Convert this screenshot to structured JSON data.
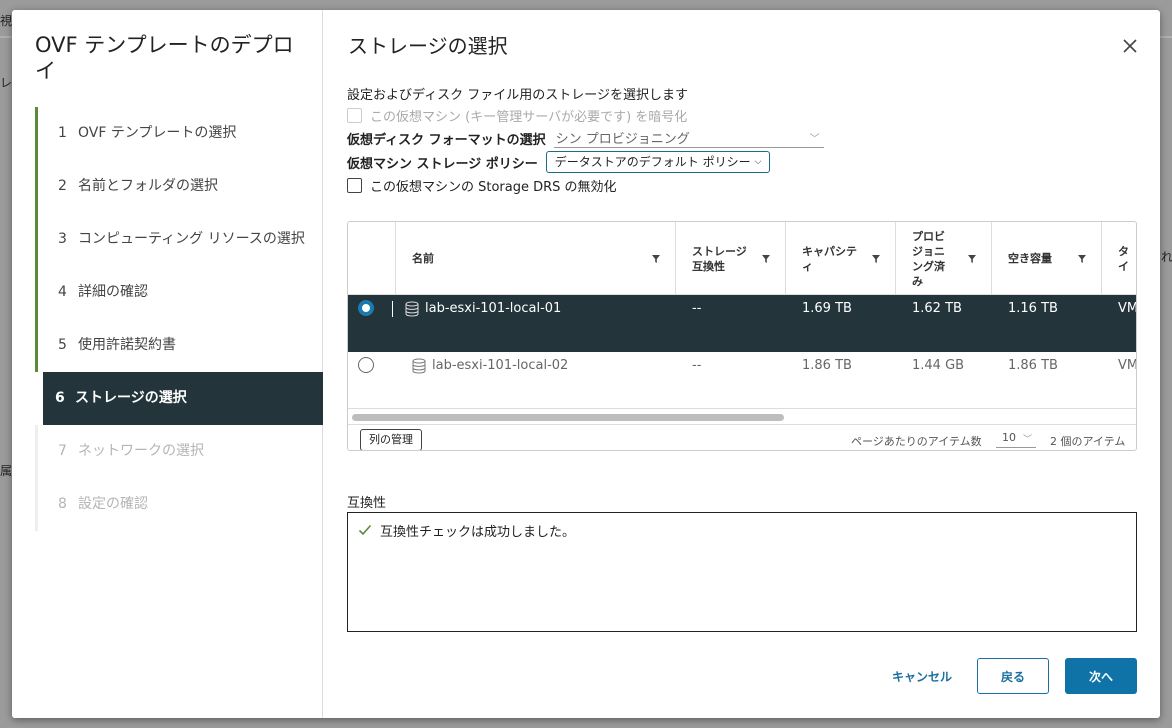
{
  "background": {
    "fragments": [
      "視",
      "レ",
      "属",
      "れ"
    ]
  },
  "wizard": {
    "title": "OVF テンプレートのデプロイ",
    "steps": [
      {
        "num": "1",
        "label": "OVF テンプレートの選択"
      },
      {
        "num": "2",
        "label": "名前とフォルダの選択"
      },
      {
        "num": "3",
        "label": "コンピューティング リソースの選択"
      },
      {
        "num": "4",
        "label": "詳細の確認"
      },
      {
        "num": "5",
        "label": "使用許諾契約書"
      },
      {
        "num": "6",
        "label": "ストレージの選択"
      },
      {
        "num": "7",
        "label": "ネットワークの選択"
      },
      {
        "num": "8",
        "label": "設定の確認"
      }
    ]
  },
  "page": {
    "title": "ストレージの選択",
    "description": "設定およびディスク ファイル用のストレージを選択します",
    "encrypt_label": "この仮想マシン (キー管理サーバが必要です) を暗号化",
    "disk_format_label": "仮想ディスク フォーマットの選択",
    "disk_format_value": "シン プロビジョニング",
    "policy_label": "仮想マシン ストレージ ポリシー",
    "policy_value": "データストアのデフォルト ポリシー",
    "sdrs_label": "この仮想マシンの Storage DRS の無効化"
  },
  "table": {
    "headers": {
      "name": "名前",
      "compat": "ストレージ互換性",
      "capacity": "キャパシティ",
      "provisioned": "プロビジョニング済み",
      "free": "空き容量",
      "type": "タイ"
    },
    "rows": [
      {
        "name": "lab-esxi-101-local-01",
        "compat": "--",
        "capacity": "1.69 TB",
        "provisioned": "1.62 TB",
        "free": "1.16 TB",
        "type": "VM"
      },
      {
        "name": "lab-esxi-101-local-02",
        "compat": "--",
        "capacity": "1.86 TB",
        "provisioned": "1.44 GB",
        "free": "1.86 TB",
        "type": "VM"
      }
    ],
    "manage_columns": "列の管理",
    "per_page_label": "ページあたりのアイテム数",
    "per_page_value": "10",
    "item_count": "2 個のアイテム"
  },
  "compat": {
    "label": "互換性",
    "message": "互換性チェックは成功しました。"
  },
  "buttons": {
    "cancel": "キャンセル",
    "back": "戻る",
    "next": "次へ"
  },
  "colors": {
    "accent": "#0f73a8",
    "selected_row": "#23343b",
    "step_done": "#5a8a3a"
  }
}
